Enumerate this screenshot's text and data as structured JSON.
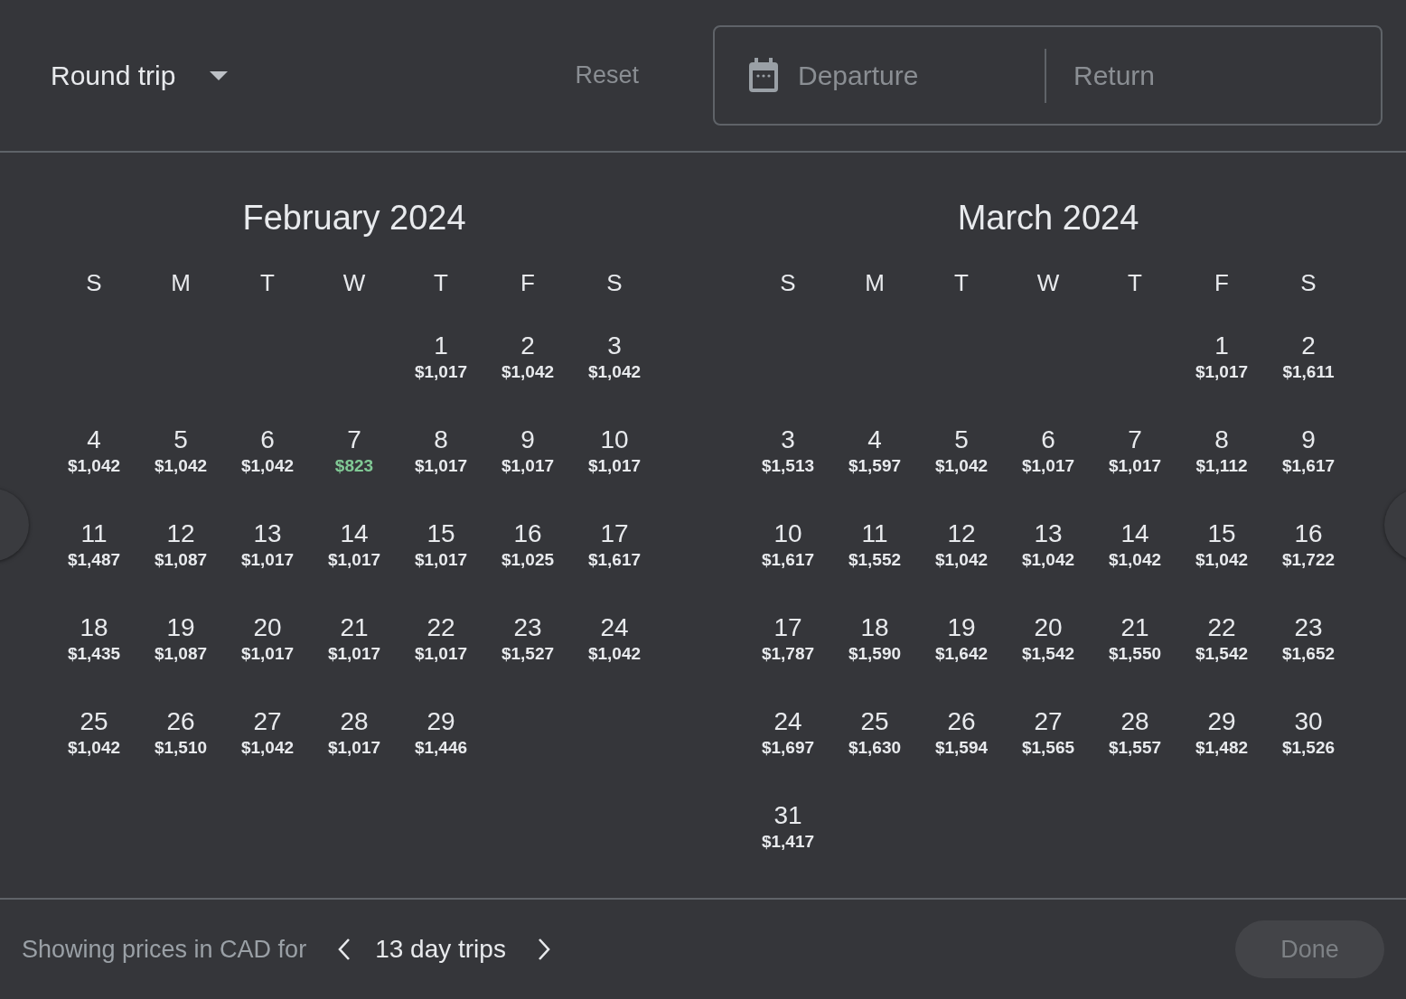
{
  "trip_type": {
    "label": "Round trip"
  },
  "reset": {
    "label": "Reset",
    "disabled": true
  },
  "date_field": {
    "departure_placeholder": "Departure",
    "return_placeholder": "Return"
  },
  "months": [
    {
      "title": "February 2024",
      "weekdays": [
        "S",
        "M",
        "T",
        "W",
        "T",
        "F",
        "S"
      ],
      "weeks": [
        {
          "days": [
            {
              "day": "1",
              "price": "$1,017",
              "cheapest": false
            },
            {
              "day": "2",
              "price": "$1,042",
              "cheapest": false
            },
            {
              "day": "3",
              "price": "$1,042",
              "cheapest": false
            }
          ]
        },
        {
          "days": [
            {
              "day": "4",
              "price": "$1,042",
              "cheapest": false
            },
            {
              "day": "5",
              "price": "$1,042",
              "cheapest": false
            },
            {
              "day": "6",
              "price": "$1,042",
              "cheapest": false
            },
            {
              "day": "7",
              "price": "$823",
              "cheapest": true
            },
            {
              "day": "8",
              "price": "$1,017",
              "cheapest": false
            },
            {
              "day": "9",
              "price": "$1,017",
              "cheapest": false
            },
            {
              "day": "10",
              "price": "$1,017",
              "cheapest": false
            }
          ]
        },
        {
          "days": [
            {
              "day": "11",
              "price": "$1,487",
              "cheapest": false
            },
            {
              "day": "12",
              "price": "$1,087",
              "cheapest": false
            },
            {
              "day": "13",
              "price": "$1,017",
              "cheapest": false
            },
            {
              "day": "14",
              "price": "$1,017",
              "cheapest": false
            },
            {
              "day": "15",
              "price": "$1,017",
              "cheapest": false
            },
            {
              "day": "16",
              "price": "$1,025",
              "cheapest": false
            },
            {
              "day": "17",
              "price": "$1,617",
              "cheapest": false
            }
          ]
        },
        {
          "days": [
            {
              "day": "18",
              "price": "$1,435",
              "cheapest": false
            },
            {
              "day": "19",
              "price": "$1,087",
              "cheapest": false
            },
            {
              "day": "20",
              "price": "$1,017",
              "cheapest": false
            },
            {
              "day": "21",
              "price": "$1,017",
              "cheapest": false
            },
            {
              "day": "22",
              "price": "$1,017",
              "cheapest": false
            },
            {
              "day": "23",
              "price": "$1,527",
              "cheapest": false
            },
            {
              "day": "24",
              "price": "$1,042",
              "cheapest": false
            }
          ]
        },
        {
          "days": [
            {
              "day": "25",
              "price": "$1,042",
              "cheapest": false
            },
            {
              "day": "26",
              "price": "$1,510",
              "cheapest": false
            },
            {
              "day": "27",
              "price": "$1,042",
              "cheapest": false
            },
            {
              "day": "28",
              "price": "$1,017",
              "cheapest": false
            },
            {
              "day": "29",
              "price": "$1,446",
              "cheapest": false
            }
          ]
        }
      ]
    },
    {
      "title": "March 2024",
      "weekdays": [
        "S",
        "M",
        "T",
        "W",
        "T",
        "F",
        "S"
      ],
      "weeks": [
        {
          "days": [
            {
              "day": "1",
              "price": "$1,017",
              "cheapest": false
            },
            {
              "day": "2",
              "price": "$1,611",
              "cheapest": false
            }
          ]
        },
        {
          "days": [
            {
              "day": "3",
              "price": "$1,513",
              "cheapest": false
            },
            {
              "day": "4",
              "price": "$1,597",
              "cheapest": false
            },
            {
              "day": "5",
              "price": "$1,042",
              "cheapest": false
            },
            {
              "day": "6",
              "price": "$1,017",
              "cheapest": false
            },
            {
              "day": "7",
              "price": "$1,017",
              "cheapest": false
            },
            {
              "day": "8",
              "price": "$1,112",
              "cheapest": false
            },
            {
              "day": "9",
              "price": "$1,617",
              "cheapest": false
            }
          ]
        },
        {
          "days": [
            {
              "day": "10",
              "price": "$1,617",
              "cheapest": false
            },
            {
              "day": "11",
              "price": "$1,552",
              "cheapest": false
            },
            {
              "day": "12",
              "price": "$1,042",
              "cheapest": false
            },
            {
              "day": "13",
              "price": "$1,042",
              "cheapest": false
            },
            {
              "day": "14",
              "price": "$1,042",
              "cheapest": false
            },
            {
              "day": "15",
              "price": "$1,042",
              "cheapest": false
            },
            {
              "day": "16",
              "price": "$1,722",
              "cheapest": false
            }
          ]
        },
        {
          "days": [
            {
              "day": "17",
              "price": "$1,787",
              "cheapest": false
            },
            {
              "day": "18",
              "price": "$1,590",
              "cheapest": false
            },
            {
              "day": "19",
              "price": "$1,642",
              "cheapest": false
            },
            {
              "day": "20",
              "price": "$1,542",
              "cheapest": false
            },
            {
              "day": "21",
              "price": "$1,550",
              "cheapest": false
            },
            {
              "day": "22",
              "price": "$1,542",
              "cheapest": false
            },
            {
              "day": "23",
              "price": "$1,652",
              "cheapest": false
            }
          ]
        },
        {
          "days": [
            {
              "day": "24",
              "price": "$1,697",
              "cheapest": false
            },
            {
              "day": "25",
              "price": "$1,630",
              "cheapest": false
            },
            {
              "day": "26",
              "price": "$1,594",
              "cheapest": false
            },
            {
              "day": "27",
              "price": "$1,565",
              "cheapest": false
            },
            {
              "day": "28",
              "price": "$1,557",
              "cheapest": false
            },
            {
              "day": "29",
              "price": "$1,482",
              "cheapest": false
            },
            {
              "day": "30",
              "price": "$1,526",
              "cheapest": false
            }
          ]
        },
        {
          "days": [
            {
              "day": "31",
              "price": "$1,417",
              "cheapest": false
            }
          ]
        }
      ]
    }
  ],
  "footer": {
    "caption": "Showing prices in CAD for",
    "trip_length": "13 day trips",
    "done": {
      "label": "Done",
      "disabled": true
    }
  }
}
